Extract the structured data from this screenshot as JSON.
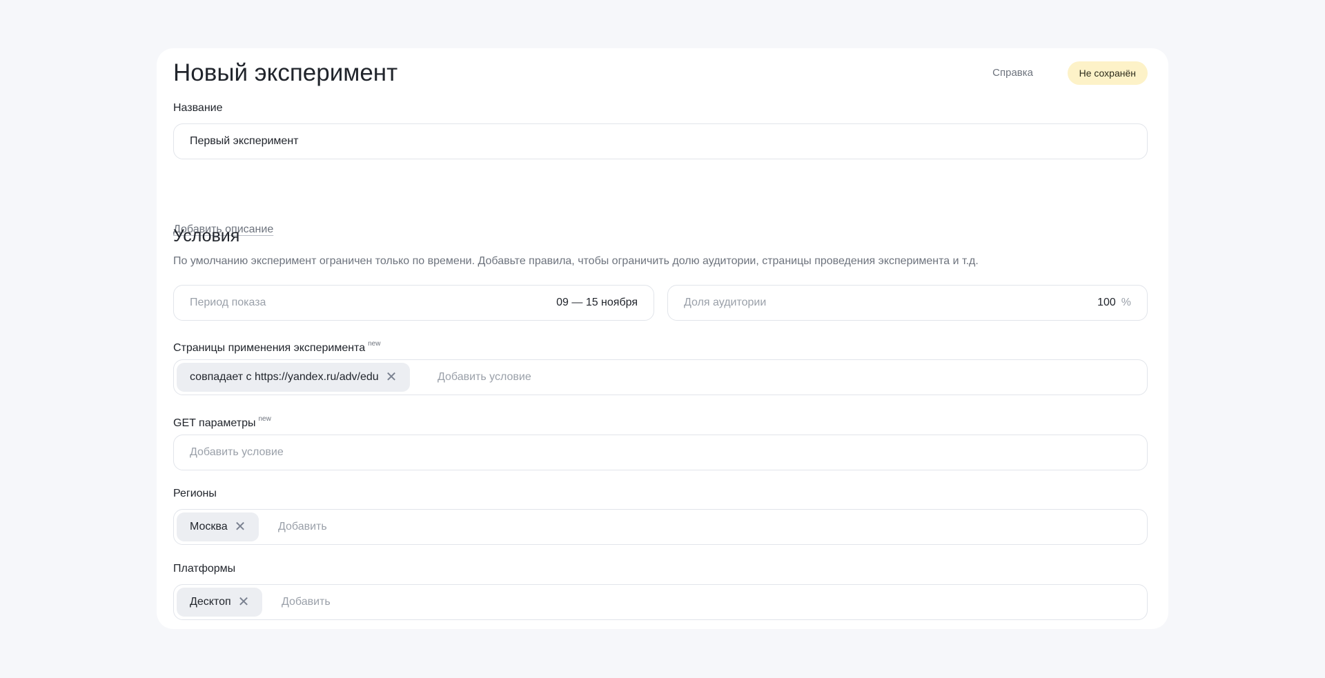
{
  "header": {
    "title": "Новый эксперимент",
    "help_label": "Справка",
    "status_badge": "Не сохранён"
  },
  "name_field": {
    "label": "Название",
    "value": "Первый эксперимент"
  },
  "add_description_link": "Добавить описание",
  "conditions": {
    "title": "Условия",
    "description": "По умолчанию эксперимент ограничен только по времени. Добавьте правила, чтобы ограничить долю аудитории, страницы проведения эксперимента и т.д.",
    "period": {
      "placeholder": "Период показа",
      "value": "09 — 15 ноября"
    },
    "audience": {
      "placeholder": "Доля аудитории",
      "value": "100",
      "unit": "%"
    }
  },
  "pages": {
    "label": "Страницы применения эксперимента",
    "badge": "new",
    "chip": "совпадает с https://yandex.ru/adv/edu",
    "add_placeholder": "Добавить условие"
  },
  "get_params": {
    "label": "GET параметры",
    "badge": "new",
    "add_placeholder": "Добавить условие"
  },
  "regions": {
    "label": "Регионы",
    "chip": "Москва",
    "add_placeholder": "Добавить"
  },
  "platforms": {
    "label": "Платформы",
    "chip": "Десктоп",
    "add_placeholder": "Добавить"
  },
  "icons": {
    "chip_remove": "close-icon"
  }
}
